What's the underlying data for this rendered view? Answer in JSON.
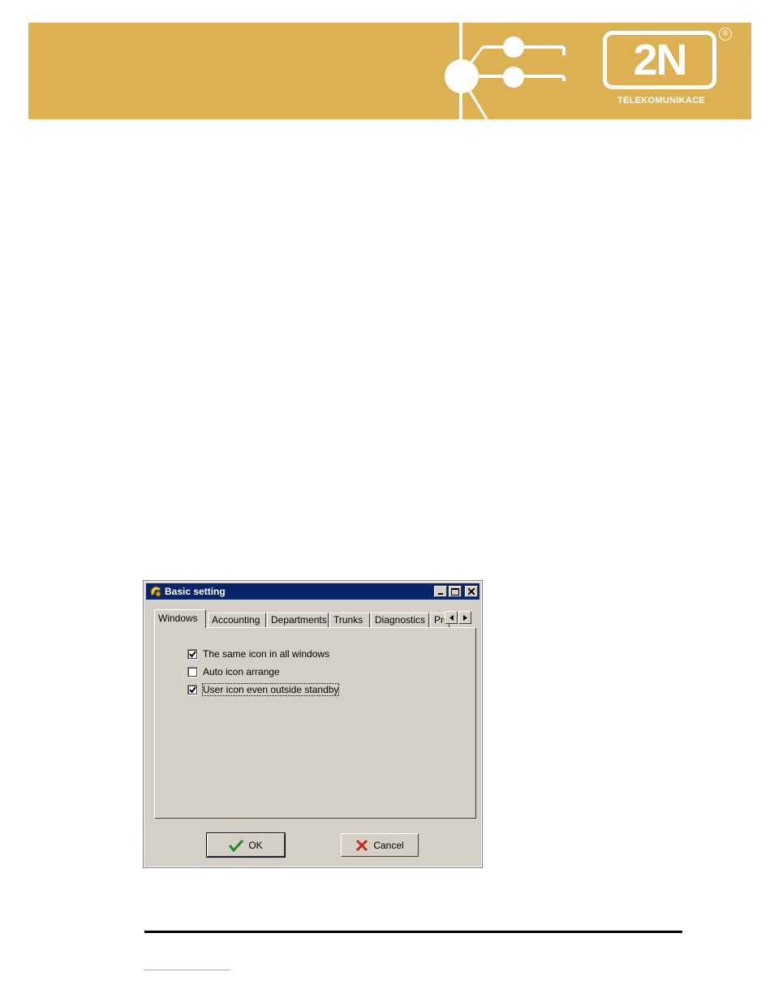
{
  "brand": {
    "logo_text": "2N",
    "registered_mark": "®",
    "tagline": "TELEKOMUNIKACE",
    "banner_color": "#dcb153"
  },
  "window": {
    "title": "Basic setting",
    "icon": "phone-handset-icon",
    "controls": [
      "minimize",
      "maximize",
      "close"
    ]
  },
  "tabs": [
    {
      "label": "Windows",
      "active": true
    },
    {
      "label": "Accounting",
      "active": false
    },
    {
      "label": "Departments",
      "active": false
    },
    {
      "label": "Trunks",
      "active": false
    },
    {
      "label": "Diagnostics",
      "active": false
    },
    {
      "label": "Pre",
      "active": false
    }
  ],
  "options": [
    {
      "label": "The same icon in all windows",
      "checked": true
    },
    {
      "label": "Auto icon arrange",
      "checked": false
    },
    {
      "label": "User icon even outside standby",
      "checked": true,
      "focused": true
    }
  ],
  "buttons": {
    "ok_label": "OK",
    "cancel_label": "Cancel"
  }
}
